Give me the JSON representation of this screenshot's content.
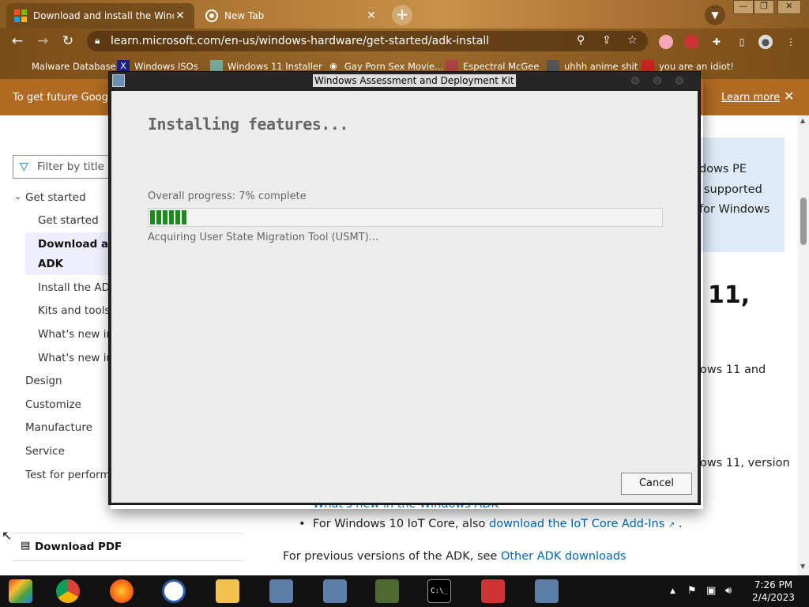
{
  "browser": {
    "tabs": [
      {
        "title": "Download and install the Windows",
        "active": true
      },
      {
        "title": "New Tab",
        "active": false
      }
    ],
    "url": "learn.microsoft.com/en-us/windows-hardware/get-started/adk-install",
    "bookmarks": [
      "Malware Database",
      "Windows ISOs",
      "Windows 11 Installer",
      "Gay Porn Sex Movie...",
      "Espectral McGee",
      "uhhh anime shit",
      "you are an idiot!"
    ],
    "infobar": {
      "text": "To get future Google",
      "learn_more": "Learn more"
    }
  },
  "page": {
    "filter_placeholder": "Filter by title",
    "toc": {
      "get_started_group": "Get started",
      "get_started": "Get started",
      "download_line1": "Download an",
      "download_line2": "ADK",
      "install_the_adk": "Install the ADK",
      "kits_and_tools": "Kits and tools o",
      "whats_new_1": "What's new in",
      "whats_new_2": "What's new in",
      "design": "Design",
      "customize": "Customize",
      "manufacture": "Manufacture",
      "service": "Service",
      "test": "Test for performa"
    },
    "callout_lines": [
      "dows PE",
      "supported",
      "for Windows"
    ],
    "heading_fragment": "11,",
    "text_fragment_1": "ows 11 and",
    "text_fragment_2": "ows 11, version",
    "bullet_hidden": "What's new in the Windows ADK",
    "bullet_iot_prefix": "For Windows 10 IoT Core, also",
    "bullet_iot_link": "download the IoT Core Add-Ins",
    "previous_prefix": "For previous versions of the ADK, see",
    "previous_link": "Other ADK downloads",
    "download_pdf": "Download PDF"
  },
  "dialog": {
    "title": "Windows Assessment and Deployment Kit",
    "heading": "Installing features...",
    "progress_label": "Overall progress: 7% complete",
    "progress_percent": 7,
    "status": "Acquiring User State Migration Tool (USMT)...",
    "cancel_label": "Cancel"
  },
  "taskbar": {
    "time": "7:26 PM",
    "date": "2/4/2023"
  }
}
